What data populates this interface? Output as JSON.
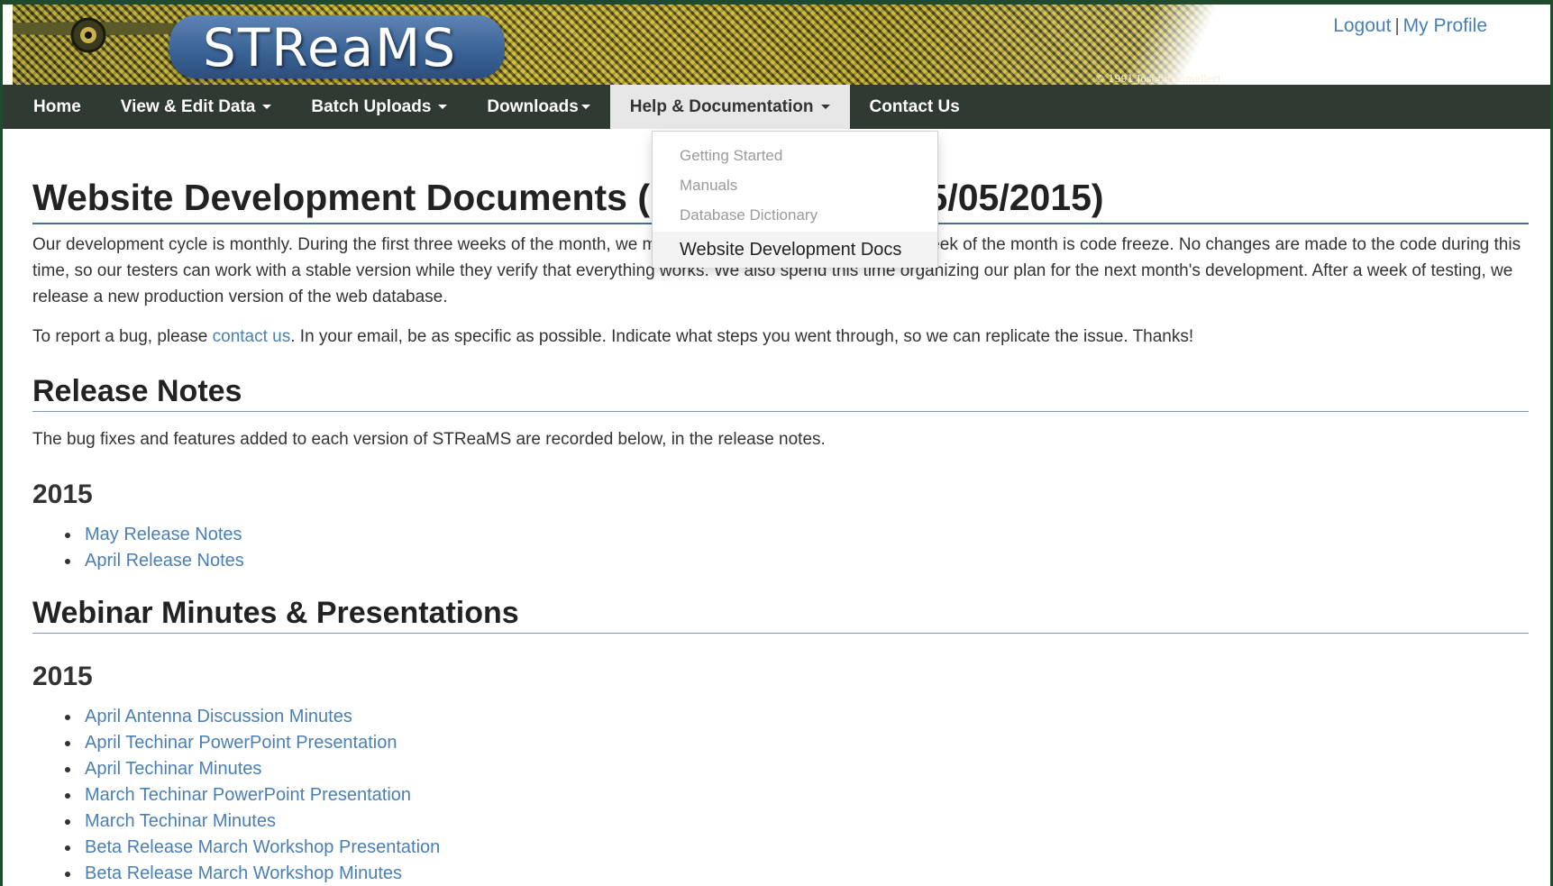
{
  "header": {
    "logo_text": "STReaMS",
    "copyright": "© 1991 Joseph Tomelleri",
    "logout": "Logout",
    "separator": "|",
    "my_profile": "My Profile"
  },
  "nav": {
    "items": [
      {
        "label": "Home"
      },
      {
        "label": "View & Edit Data"
      },
      {
        "label": "Batch Uploads"
      },
      {
        "label": "Downloads"
      },
      {
        "label": "Help & Documentation"
      },
      {
        "label": "Contact Us"
      }
    ],
    "active_index": 4
  },
  "dropdown": {
    "items": [
      {
        "label": "Getting Started"
      },
      {
        "label": "Manuals"
      },
      {
        "label": "Database Dictionary"
      },
      {
        "label": "Website Development Docs"
      }
    ]
  },
  "main": {
    "title": "Website Development Documents (Last Updated: 05/05/2015)",
    "intro": "Our development cycle is monthly. During the first three weeks of the month, we make changes to the code. The last week of the month is code freeze. No changes are made to the code during this time, so our testers can work with a stable version while they verify that everything works. We also spend this time organizing our plan for the next month's development. After a week of testing, we release a new production version of the web database.",
    "bug_prefix": "To report a bug, please ",
    "bug_link": "contact us",
    "bug_suffix": ". In your email, be as specific as possible. Indicate what steps you went through, so we can replicate the issue. Thanks!",
    "release_heading": "Release Notes",
    "release_text": "The bug fixes and features added to each version of STReaMS are recorded below, in the release notes.",
    "release_year": "2015",
    "release_links": [
      "May Release Notes",
      "April Release Notes"
    ],
    "webinar_heading": "Webinar Minutes & Presentations",
    "webinar_year": "2015",
    "webinar_links": [
      "April Antenna Discussion Minutes",
      "April Techinar PowerPoint Presentation",
      "April Techinar Minutes",
      "March Techinar PowerPoint Presentation",
      "March Techinar Minutes",
      "Beta Release March Workshop Presentation",
      "Beta Release March Workshop Minutes"
    ]
  },
  "colors": {
    "nav_bg": "#2e3a32",
    "link": "#4a7fb5",
    "outer_bg": "#1f4a2e"
  }
}
